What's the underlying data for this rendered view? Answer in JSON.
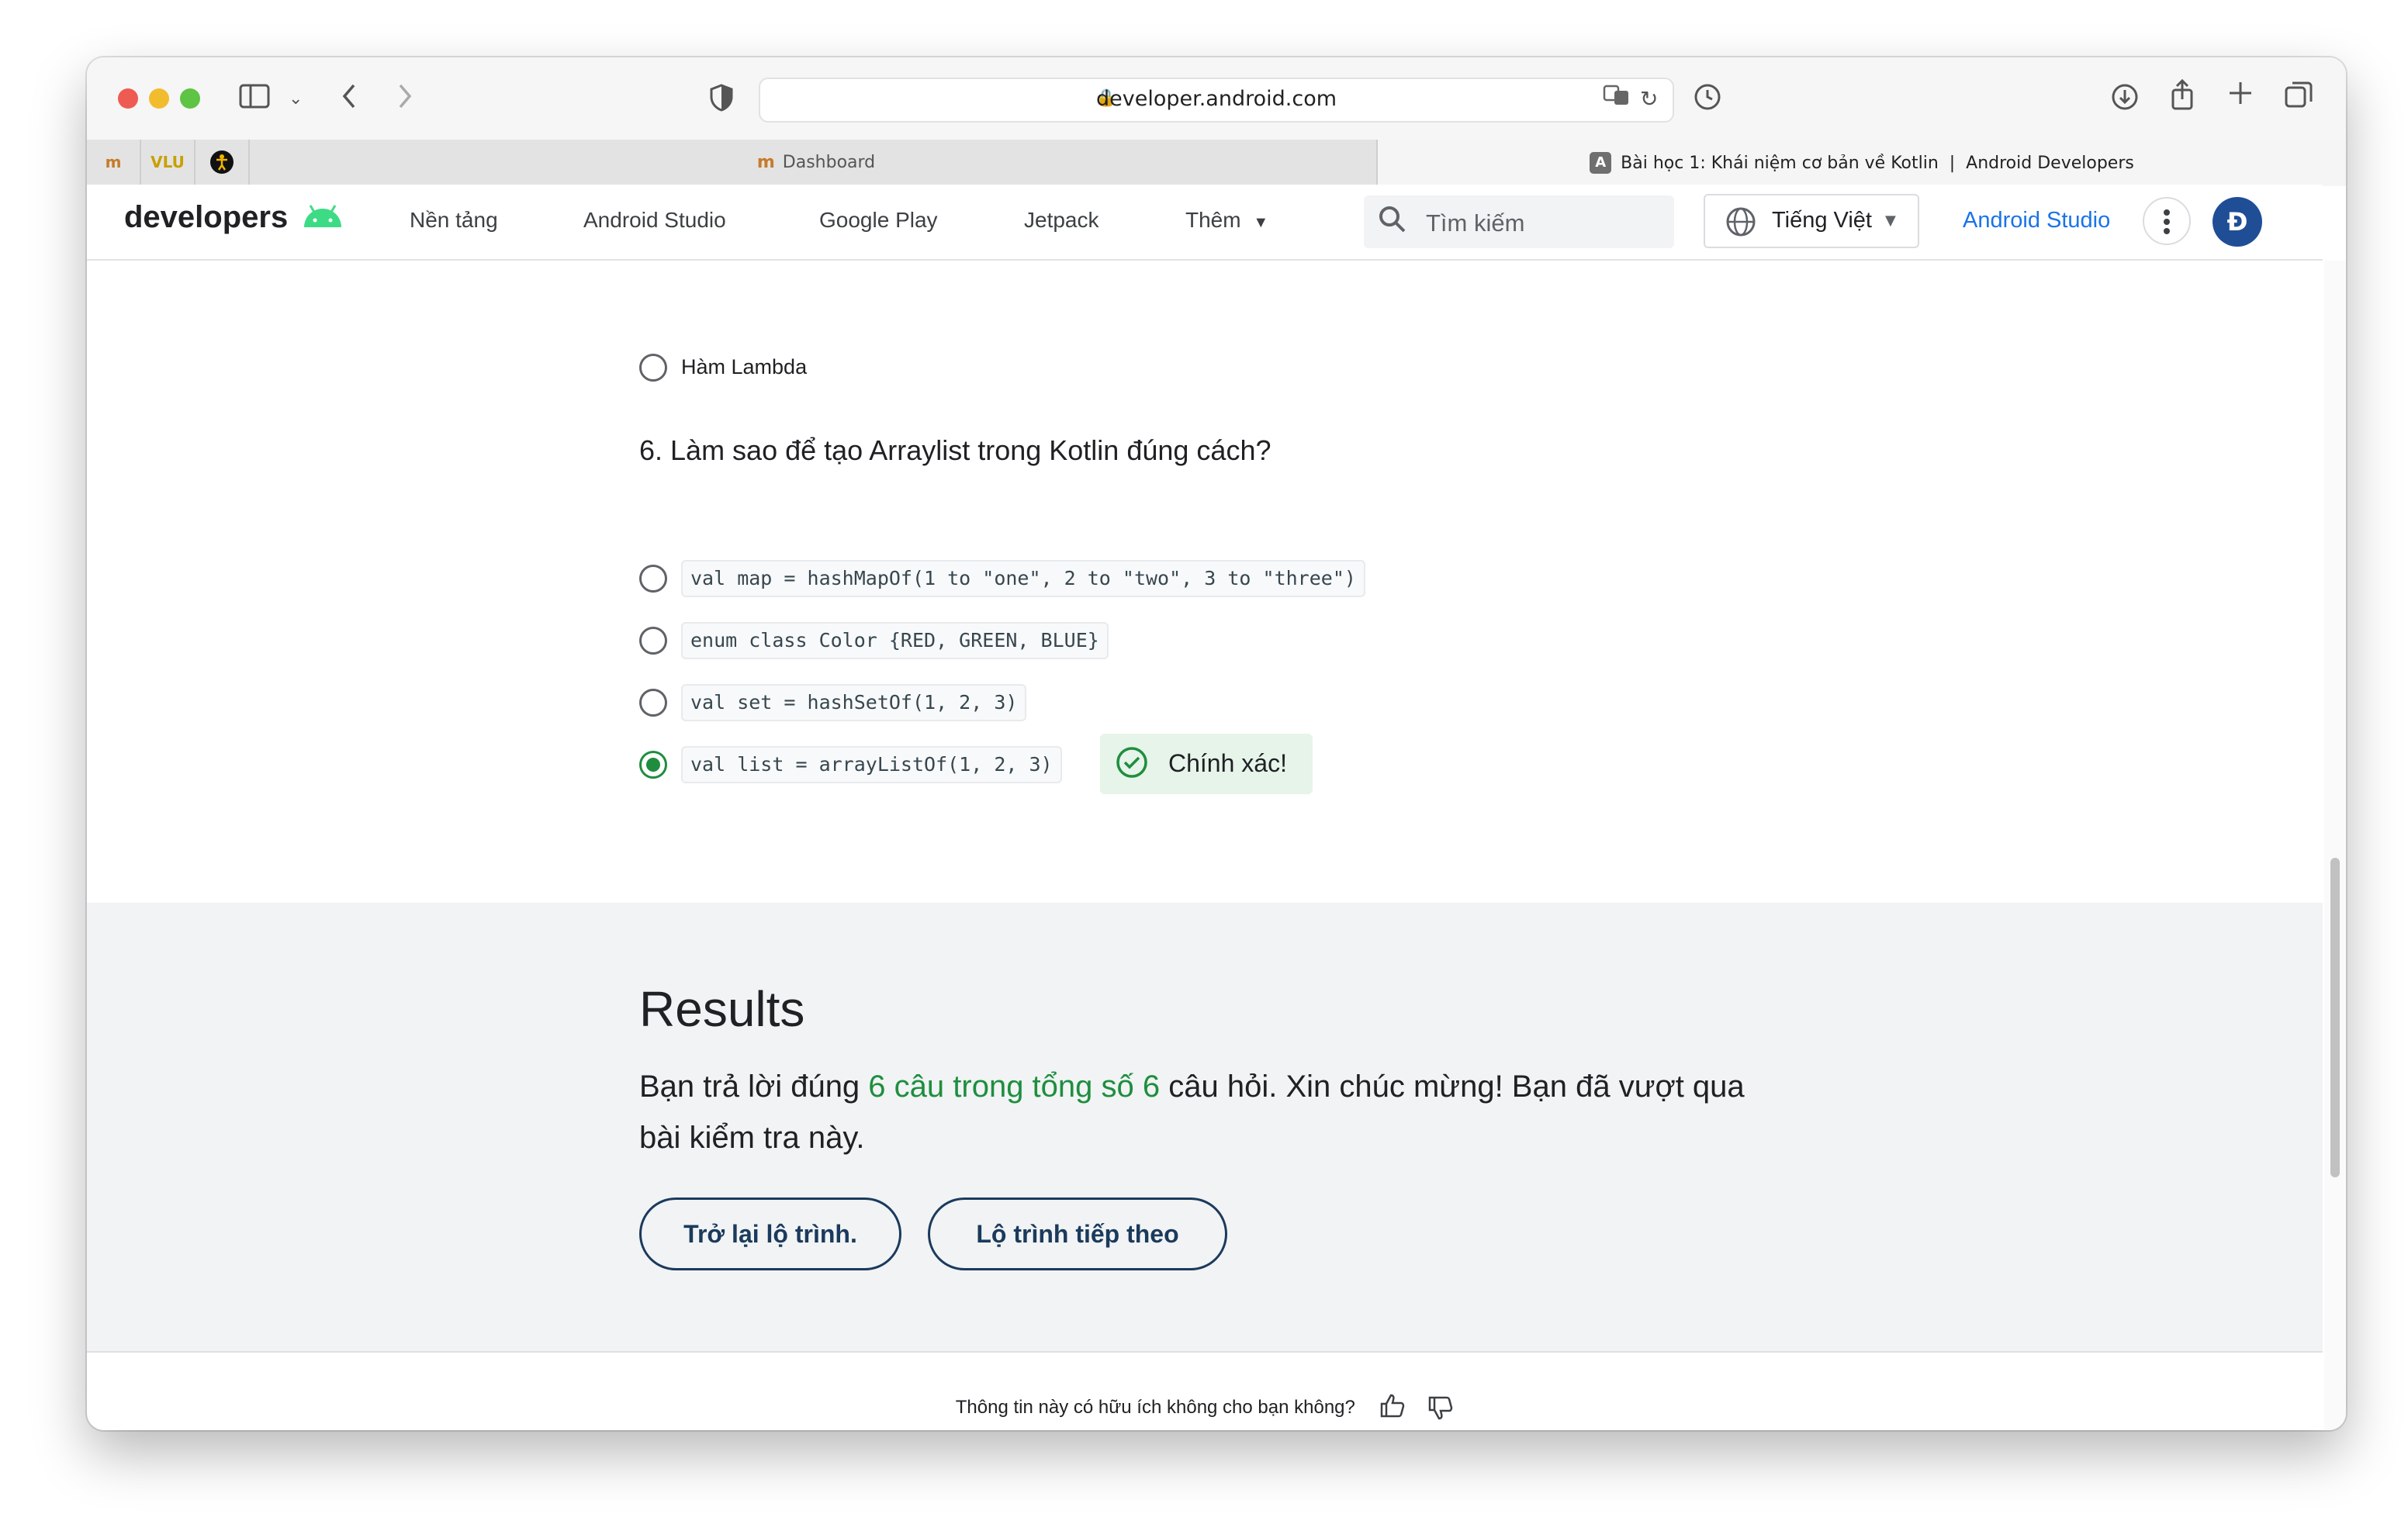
{
  "browser": {
    "url": "developer.android.com",
    "tabs": {
      "pinned": [
        "m",
        "VLU",
        "☉"
      ],
      "dashboard": "Dashboard",
      "active": "Bài học 1: Khái niệm cơ bản về Kotlin  |  Android Developers",
      "active_favicon": "A"
    }
  },
  "header": {
    "logo": "developers",
    "nav": [
      "Nền tảng",
      "Android Studio",
      "Google Play",
      "Jetpack",
      "Thêm"
    ],
    "search_placeholder": "Tìm kiếm",
    "language": "Tiếng Việt",
    "studio_link": "Android Studio",
    "avatar_letter": "Đ"
  },
  "quiz": {
    "previous_option": "Hàm Lambda",
    "question": "6. Làm sao để tạo Arraylist trong Kotlin đúng cách?",
    "options": [
      "val map = hashMapOf(1 to \"one\", 2 to \"two\", 3 to \"three\")",
      "enum class Color {RED, GREEN, BLUE}",
      "val set = hashSetOf(1, 2, 3)",
      "val list = arrayListOf(1, 2, 3)"
    ],
    "selected_index": 3,
    "feedback": "Chính xác!"
  },
  "results": {
    "title": "Results",
    "text_before": "Bạn trả lời đúng ",
    "highlight": "6 câu trong tổng số 6",
    "text_after": " câu hỏi. Xin chúc mừng! Bạn đã vượt qua bài kiểm tra này.",
    "back_button": "Trở lại lộ trình.",
    "next_button": "Lộ trình tiếp theo"
  },
  "footer": {
    "feedback_question": "Thông tin này có hữu ích không cho bạn không?"
  },
  "colors": {
    "accent_green": "#1e8e3e",
    "link_blue": "#1a73e8",
    "button_navy": "#1b3a5c"
  }
}
